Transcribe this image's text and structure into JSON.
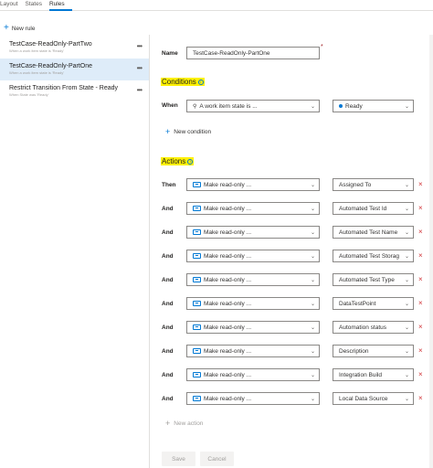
{
  "tabs": [
    "Layout",
    "States",
    "Rules"
  ],
  "active_tab": "Rules",
  "toolbar": {
    "new_rule": "New rule"
  },
  "rules": [
    {
      "title": "TestCase-ReadOnly-PartTwo",
      "subtitle": "When a work item state is 'Ready'"
    },
    {
      "title": "TestCase-ReadOnly-PartOne",
      "subtitle": "When a work item state is 'Ready'"
    },
    {
      "title": "Restrict Transition From State - Ready",
      "subtitle": "When State was 'Ready'"
    }
  ],
  "selected_rule_index": 1,
  "editor": {
    "name_label": "Name",
    "name_value": "TestCase-ReadOnly-PartOne",
    "required_marker": "*",
    "conditions_heading": "Conditions",
    "when_label": "When",
    "condition_field": "A work item state is ...",
    "condition_value": "Ready",
    "new_condition": "New condition",
    "actions_heading": "Actions",
    "actions": [
      {
        "connector": "Then",
        "action": "Make read-only ...",
        "field": "Assigned To"
      },
      {
        "connector": "And",
        "action": "Make read-only ...",
        "field": "Automated Test Id"
      },
      {
        "connector": "And",
        "action": "Make read-only ...",
        "field": "Automated Test Name"
      },
      {
        "connector": "And",
        "action": "Make read-only ...",
        "field": "Automated Test Storag"
      },
      {
        "connector": "And",
        "action": "Make read-only ...",
        "field": "Automated Test Type"
      },
      {
        "connector": "And",
        "action": "Make read-only ...",
        "field": "DataTestPoint"
      },
      {
        "connector": "And",
        "action": "Make read-only ...",
        "field": "Automation status"
      },
      {
        "connector": "And",
        "action": "Make read-only ...",
        "field": "Description"
      },
      {
        "connector": "And",
        "action": "Make read-only ...",
        "field": "Integration Build"
      },
      {
        "connector": "And",
        "action": "Make read-only ...",
        "field": "Local Data Source"
      }
    ],
    "new_action": "New action",
    "save": "Save",
    "cancel": "Cancel"
  },
  "icons": {
    "delete": "×",
    "chevron": "⌄",
    "info": "i",
    "more": "•••"
  },
  "colors": {
    "accent": "#0078d4",
    "highlight": "#fff100",
    "delete": "#d13438",
    "selected_bg": "#deecf9"
  }
}
